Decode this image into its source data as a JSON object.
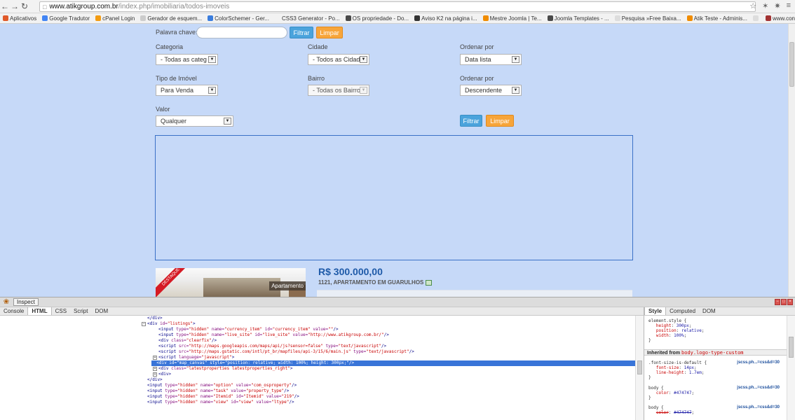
{
  "browser": {
    "url_host": "www.atikgroup.com.br",
    "url_path": "/index.php/imobiliaria/todos-imoveis",
    "bookmarks": [
      {
        "label": "Aplicativos",
        "color": "#e05a2a"
      },
      {
        "label": "Google Tradutor",
        "color": "#4285f4"
      },
      {
        "label": "cPanel Login",
        "color": "#f39c12"
      },
      {
        "label": "Gerador de esquem...",
        "color": "#cccccc"
      },
      {
        "label": "ColorSchemer - Ger...",
        "color": "#3b7ddd"
      },
      {
        "label": "CSS3 Generator - Po...",
        "color": "#f2f2f2"
      },
      {
        "label": "OS propriedade - Do...",
        "color": "#4a4a4a"
      },
      {
        "label": "Aviso K2 na página i...",
        "color": "#333333"
      },
      {
        "label": "Mestre Joomla | Te...",
        "color": "#f08c00"
      },
      {
        "label": "Joomla Templates - ...",
        "color": "#4a4a4a"
      },
      {
        "label": "Pesquisa »Free Baixa...",
        "color": "#dddddd"
      },
      {
        "label": "Atik Teste - Adminis...",
        "color": "#f08c00"
      },
      {
        "label": "",
        "color": "#dddddd"
      },
      {
        "label": "www.connection.uf...",
        "color": "#a33333"
      }
    ]
  },
  "search": {
    "keyword_label": "Palavra chave:",
    "keyword_value": "",
    "filter_label": "Filtrar",
    "clear_label": "Limpar",
    "categoria_label": "Categoria",
    "categoria_value": "- Todas as categ",
    "cidade_label": "Cidade",
    "cidade_value": "- Todos as Cidad",
    "ordenar1_label": "Ordenar por",
    "ordenar1_value": "Data lista",
    "tipo_label": "Tipo de Imóvel",
    "tipo_value": "Para Venda",
    "bairro_label": "Bairro",
    "bairro_value": "- Todas os Bairro",
    "ordenar2_label": "Ordenar por",
    "ordenar2_value": "Descendente",
    "valor_label": "Valor",
    "valor_value": "Qualquer"
  },
  "listing": {
    "badge": "DESTAQUE",
    "type_chip": "Apartamento",
    "price": "R$ 300.000,00",
    "title": "1121, APARTAMENTO EM GUARULHOS"
  },
  "devtools": {
    "inspect_label": "Inspect",
    "tabs": [
      "Console",
      "HTML",
      "CSS",
      "Script",
      "DOM"
    ],
    "side_tabs": [
      "Style",
      "Computed",
      "DOM"
    ],
    "inherited_label": "Inherited from",
    "inherited_selector": "body.logo-type-custom",
    "source_link": "jscss.ph...=css&d=30"
  },
  "colors": {
    "page_bg": "#c6d9f8",
    "filter_blue": "#4aa3dc",
    "clear_orange": "#f7a53a",
    "price_blue": "#1e5aa8",
    "selection": "#3874d8"
  }
}
